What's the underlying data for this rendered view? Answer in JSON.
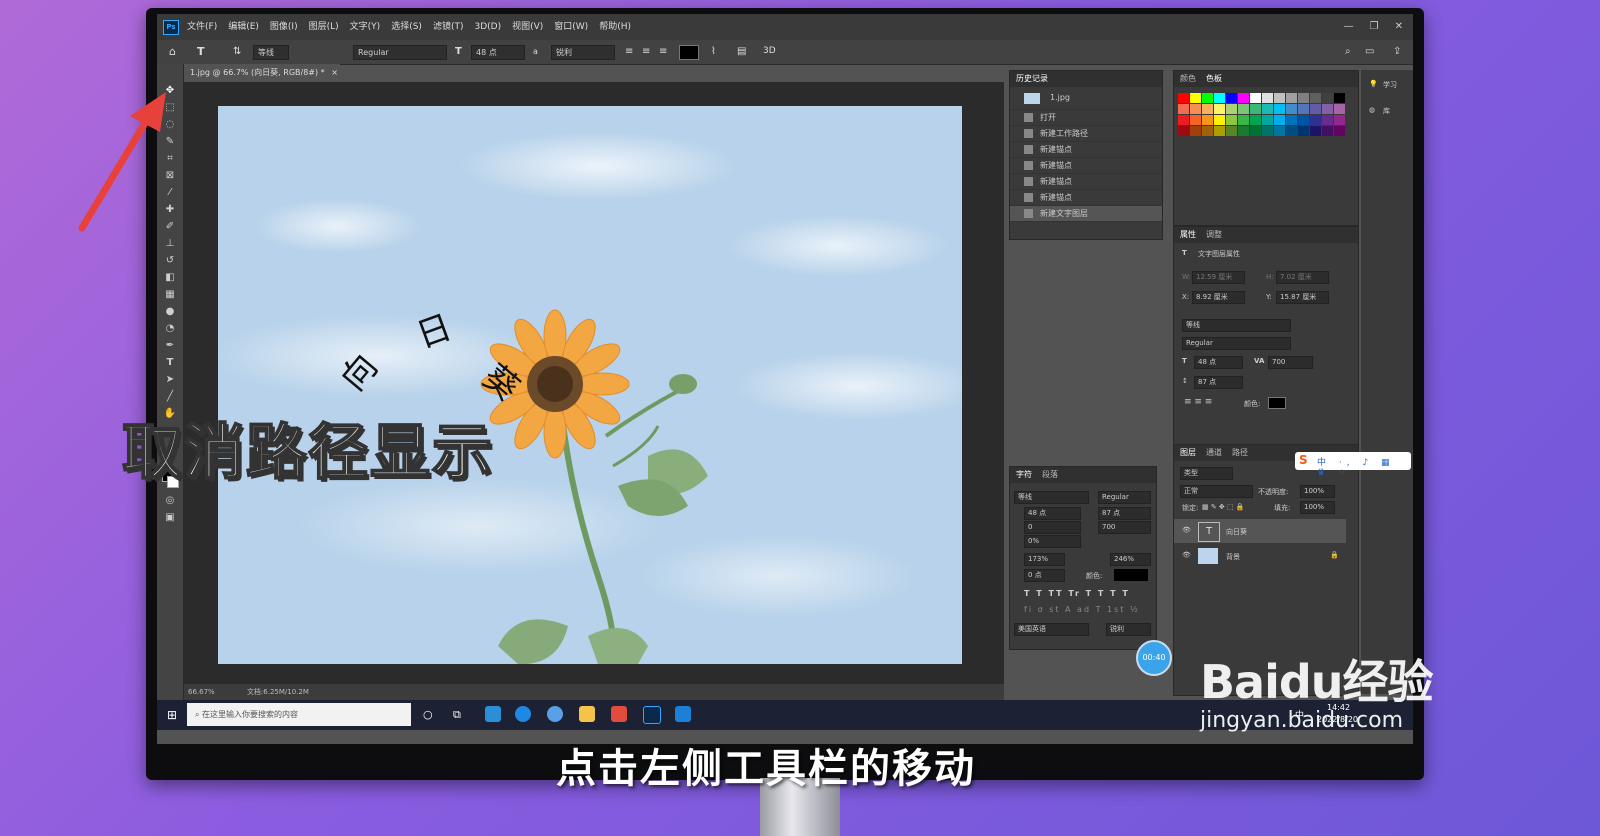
{
  "menubar": {
    "app_icon": "Ps",
    "items": [
      "文件(F)",
      "编辑(E)",
      "图像(I)",
      "图层(L)",
      "文字(Y)",
      "选择(S)",
      "滤镜(T)",
      "3D(D)",
      "视图(V)",
      "窗口(W)",
      "帮助(H)"
    ],
    "window_controls": [
      "—",
      "❐",
      "✕"
    ]
  },
  "options_bar": {
    "font_family": "等线",
    "font_style": "Regular",
    "font_size": "48 点",
    "antialias": "锐利",
    "label_3d": "3D"
  },
  "document": {
    "tab_title": "1.jpg @ 66.7% (向日葵, RGB/8#) *",
    "zoom": "66.67%",
    "doc_size": "文档:6.25M/10.2M",
    "path_text": [
      "向",
      "日",
      "葵"
    ]
  },
  "history": {
    "tab": "历史记录",
    "snapshot": "1.jpg",
    "items": [
      "打开",
      "新建工作路径",
      "新建锚点",
      "新建锚点",
      "新建锚点",
      "新建锚点",
      "新建文字图层"
    ]
  },
  "swatches": {
    "tabs": [
      "颜色",
      "色板"
    ],
    "colors": [
      "#ff0000",
      "#ffff00",
      "#00ff00",
      "#00ffff",
      "#0000ff",
      "#ff00ff",
      "#ffffff",
      "#e0e0e0",
      "#c0c0c0",
      "#a0a0a0",
      "#808080",
      "#606060",
      "#404040",
      "#000000",
      "#f26c4f",
      "#f68e55",
      "#fbaf5c",
      "#fff467",
      "#acd372",
      "#7cc576",
      "#3bb878",
      "#1abbb4",
      "#00bff3",
      "#438ccb",
      "#5574b9",
      "#605ca8",
      "#855fa8",
      "#a763a8",
      "#ed1c24",
      "#f26522",
      "#f7941d",
      "#fff200",
      "#8dc63f",
      "#39b54a",
      "#00a651",
      "#00a99d",
      "#00aeef",
      "#0072bc",
      "#0054a6",
      "#2e3192",
      "#662d91",
      "#92278f",
      "#9e0b0f",
      "#a0410d",
      "#a36209",
      "#aba000",
      "#598527",
      "#1a7b30",
      "#007236",
      "#00746b",
      "#0076a3",
      "#004b80",
      "#003471",
      "#1b1464",
      "#440e62",
      "#630460"
    ]
  },
  "properties": {
    "tabs": [
      "属性",
      "调整"
    ],
    "title": "文字图层属性",
    "w_label": "W:",
    "w": "12.59 厘米",
    "h_label": "H:",
    "h": "7.02 厘米",
    "x_label": "X:",
    "x": "8.92 厘米",
    "y_label": "Y:",
    "y": "15.87 厘米",
    "font": "等线",
    "style": "Regular",
    "size": "48 点",
    "tracking": "700",
    "leading": "87 点",
    "color_label": "颜色:"
  },
  "character": {
    "tabs": [
      "字符",
      "段落"
    ],
    "font": "等线",
    "style": "Regular",
    "size": "48 点",
    "leading": "87 点",
    "kerning": "0",
    "tracking": "700",
    "scale": "0%",
    "vscale": "173%",
    "hscale": "246%",
    "baseline": "0 点",
    "color_label": "颜色:",
    "language": "美国英语",
    "aa": "锐利"
  },
  "layers": {
    "tabs": [
      "图层",
      "通道",
      "路径"
    ],
    "filter": "类型",
    "blend": "正常",
    "opacity_label": "不透明度:",
    "opacity": "100%",
    "lock_label": "锁定:",
    "fill_label": "填充:",
    "fill": "100%",
    "items": [
      {
        "name": "向日葵",
        "type": "text"
      },
      {
        "name": "背景",
        "type": "image"
      }
    ]
  },
  "right_dock": {
    "learn": "学习",
    "library": "库"
  },
  "taskbar": {
    "search_placeholder": "在这里输入你要搜索的内容",
    "time": "14:42",
    "date": "2022/8/20",
    "ime": "中"
  },
  "overlay": {
    "big_caption": "取消路径显示",
    "subtitle": "点击左侧工具栏的移动",
    "timer": "00:40",
    "watermark": "Baidu经验",
    "watermark_url": "jingyan.baidu.com"
  },
  "colors": {
    "accent": "#31a8ff",
    "arrow": "#e8413c",
    "sky": "#b7d2ea"
  }
}
